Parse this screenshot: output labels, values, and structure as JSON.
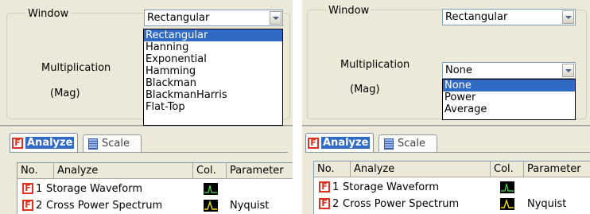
{
  "left": {
    "window_label": "Window",
    "window_value": "Rectangular",
    "window_options": [
      "Rectangular",
      "Hanning",
      "Exponential",
      "Hamming",
      "Blackman",
      "BlackmanHarris",
      "Flat-Top"
    ],
    "multiplication_label": "Multiplication",
    "mag_label": "(Mag)",
    "tabs": [
      "Analyze",
      "Scale"
    ],
    "table": {
      "columns": [
        "No.",
        "Analyze",
        "Col.",
        "Parameter"
      ],
      "rows": [
        {
          "no": "1",
          "analyze": "Storage Waveform",
          "parameter": ""
        },
        {
          "no": "2",
          "analyze": "Cross Power Spectrum",
          "parameter": "Nyquist"
        }
      ]
    }
  },
  "right": {
    "window_label": "Window",
    "window_value": "Rectangular",
    "multiplication_label": "Multiplication",
    "multiplication_value": "None",
    "multiplication_options": [
      "None",
      "Power",
      "Average"
    ],
    "mag_label": "(Mag)",
    "tabs": [
      "Analyze",
      "Scale"
    ],
    "table": {
      "columns": [
        "No.",
        "Analyze",
        "Col.",
        "Parameter"
      ],
      "rows": [
        {
          "no": "1",
          "analyze": "Storage Waveform",
          "parameter": ""
        },
        {
          "no": "2",
          "analyze": "Cross Power Spectrum",
          "parameter": "Nyquist"
        }
      ]
    }
  },
  "icons": {
    "tab_analyze": "f-icon",
    "tab_scale": "scale-icon",
    "row_marker": "f-icon",
    "color_swatch": "waveform-icon"
  },
  "colors": {
    "selection": "#316ac5",
    "panel_bg": "#ece9d8",
    "f_icon": "#e0301e",
    "waveform": "#f5e000"
  }
}
